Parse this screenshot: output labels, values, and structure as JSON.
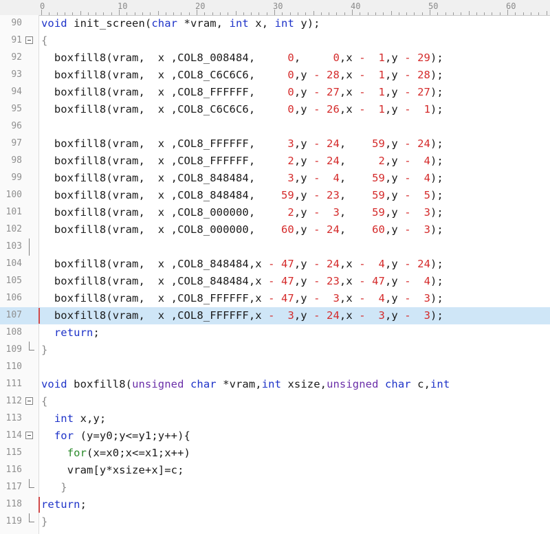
{
  "ruler": {
    "labels": [
      "0",
      "10",
      "20",
      "30",
      "40",
      "50",
      "60"
    ]
  },
  "lines": [
    {
      "n": "90",
      "tokens": [
        [
          "kw",
          "void"
        ],
        [
          "t",
          " init_screen("
        ],
        [
          "kw",
          "char"
        ],
        [
          "t",
          " *vram, "
        ],
        [
          "kw",
          "int"
        ],
        [
          "t",
          " x, "
        ],
        [
          "kw",
          "int"
        ],
        [
          "t",
          " y);"
        ]
      ]
    },
    {
      "n": "91",
      "fold": "open",
      "tokens": [
        [
          "brace",
          "{"
        ]
      ]
    },
    {
      "n": "92",
      "tokens": [
        [
          "t",
          "  boxfill8(vram,  x ,COL8_008484,     "
        ],
        [
          "num",
          "0"
        ],
        [
          "t",
          ",     "
        ],
        [
          "num",
          "0"
        ],
        [
          "t",
          ",x "
        ],
        [
          "op",
          "-"
        ],
        [
          "t",
          "  "
        ],
        [
          "num",
          "1"
        ],
        [
          "t",
          ",y "
        ],
        [
          "op",
          "-"
        ],
        [
          "t",
          " "
        ],
        [
          "num",
          "29"
        ],
        [
          "t",
          ");"
        ]
      ]
    },
    {
      "n": "93",
      "tokens": [
        [
          "t",
          "  boxfill8(vram,  x ,COL8_C6C6C6,     "
        ],
        [
          "num",
          "0"
        ],
        [
          "t",
          ",y "
        ],
        [
          "op",
          "-"
        ],
        [
          "t",
          " "
        ],
        [
          "num",
          "28"
        ],
        [
          "t",
          ",x "
        ],
        [
          "op",
          "-"
        ],
        [
          "t",
          "  "
        ],
        [
          "num",
          "1"
        ],
        [
          "t",
          ",y "
        ],
        [
          "op",
          "-"
        ],
        [
          "t",
          " "
        ],
        [
          "num",
          "28"
        ],
        [
          "t",
          ");"
        ]
      ]
    },
    {
      "n": "94",
      "tokens": [
        [
          "t",
          "  boxfill8(vram,  x ,COL8_FFFFFF,     "
        ],
        [
          "num",
          "0"
        ],
        [
          "t",
          ",y "
        ],
        [
          "op",
          "-"
        ],
        [
          "t",
          " "
        ],
        [
          "num",
          "27"
        ],
        [
          "t",
          ",x "
        ],
        [
          "op",
          "-"
        ],
        [
          "t",
          "  "
        ],
        [
          "num",
          "1"
        ],
        [
          "t",
          ",y "
        ],
        [
          "op",
          "-"
        ],
        [
          "t",
          " "
        ],
        [
          "num",
          "27"
        ],
        [
          "t",
          ");"
        ]
      ]
    },
    {
      "n": "95",
      "tokens": [
        [
          "t",
          "  boxfill8(vram,  x ,COL8_C6C6C6,     "
        ],
        [
          "num",
          "0"
        ],
        [
          "t",
          ",y "
        ],
        [
          "op",
          "-"
        ],
        [
          "t",
          " "
        ],
        [
          "num",
          "26"
        ],
        [
          "t",
          ",x "
        ],
        [
          "op",
          "-"
        ],
        [
          "t",
          "  "
        ],
        [
          "num",
          "1"
        ],
        [
          "t",
          ",y "
        ],
        [
          "op",
          "-"
        ],
        [
          "t",
          "  "
        ],
        [
          "num",
          "1"
        ],
        [
          "t",
          ");"
        ]
      ]
    },
    {
      "n": "96",
      "tokens": []
    },
    {
      "n": "97",
      "tokens": [
        [
          "t",
          "  boxfill8(vram,  x ,COL8_FFFFFF,     "
        ],
        [
          "num",
          "3"
        ],
        [
          "t",
          ",y "
        ],
        [
          "op",
          "-"
        ],
        [
          "t",
          " "
        ],
        [
          "num",
          "24"
        ],
        [
          "t",
          ",    "
        ],
        [
          "num",
          "59"
        ],
        [
          "t",
          ",y "
        ],
        [
          "op",
          "-"
        ],
        [
          "t",
          " "
        ],
        [
          "num",
          "24"
        ],
        [
          "t",
          ");"
        ]
      ]
    },
    {
      "n": "98",
      "tokens": [
        [
          "t",
          "  boxfill8(vram,  x ,COL8_FFFFFF,     "
        ],
        [
          "num",
          "2"
        ],
        [
          "t",
          ",y "
        ],
        [
          "op",
          "-"
        ],
        [
          "t",
          " "
        ],
        [
          "num",
          "24"
        ],
        [
          "t",
          ",     "
        ],
        [
          "num",
          "2"
        ],
        [
          "t",
          ",y "
        ],
        [
          "op",
          "-"
        ],
        [
          "t",
          "  "
        ],
        [
          "num",
          "4"
        ],
        [
          "t",
          ");"
        ]
      ]
    },
    {
      "n": "99",
      "tokens": [
        [
          "t",
          "  boxfill8(vram,  x ,COL8_848484,     "
        ],
        [
          "num",
          "3"
        ],
        [
          "t",
          ",y "
        ],
        [
          "op",
          "-"
        ],
        [
          "t",
          "  "
        ],
        [
          "num",
          "4"
        ],
        [
          "t",
          ",    "
        ],
        [
          "num",
          "59"
        ],
        [
          "t",
          ",y "
        ],
        [
          "op",
          "-"
        ],
        [
          "t",
          "  "
        ],
        [
          "num",
          "4"
        ],
        [
          "t",
          ");"
        ]
      ]
    },
    {
      "n": "100",
      "tokens": [
        [
          "t",
          "  boxfill8(vram,  x ,COL8_848484,    "
        ],
        [
          "num",
          "59"
        ],
        [
          "t",
          ",y "
        ],
        [
          "op",
          "-"
        ],
        [
          "t",
          " "
        ],
        [
          "num",
          "23"
        ],
        [
          "t",
          ",    "
        ],
        [
          "num",
          "59"
        ],
        [
          "t",
          ",y "
        ],
        [
          "op",
          "-"
        ],
        [
          "t",
          "  "
        ],
        [
          "num",
          "5"
        ],
        [
          "t",
          ");"
        ]
      ]
    },
    {
      "n": "101",
      "tokens": [
        [
          "t",
          "  boxfill8(vram,  x ,COL8_000000,     "
        ],
        [
          "num",
          "2"
        ],
        [
          "t",
          ",y "
        ],
        [
          "op",
          "-"
        ],
        [
          "t",
          "  "
        ],
        [
          "num",
          "3"
        ],
        [
          "t",
          ",    "
        ],
        [
          "num",
          "59"
        ],
        [
          "t",
          ",y "
        ],
        [
          "op",
          "-"
        ],
        [
          "t",
          "  "
        ],
        [
          "num",
          "3"
        ],
        [
          "t",
          ");"
        ]
      ]
    },
    {
      "n": "102",
      "tokens": [
        [
          "t",
          "  boxfill8(vram,  x ,COL8_000000,    "
        ],
        [
          "num",
          "60"
        ],
        [
          "t",
          ",y "
        ],
        [
          "op",
          "-"
        ],
        [
          "t",
          " "
        ],
        [
          "num",
          "24"
        ],
        [
          "t",
          ",    "
        ],
        [
          "num",
          "60"
        ],
        [
          "t",
          ",y "
        ],
        [
          "op",
          "-"
        ],
        [
          "t",
          "  "
        ],
        [
          "num",
          "3"
        ],
        [
          "t",
          ");"
        ]
      ]
    },
    {
      "n": "103",
      "fold": "vert",
      "tokens": []
    },
    {
      "n": "104",
      "tokens": [
        [
          "t",
          "  boxfill8(vram,  x ,COL8_848484,x "
        ],
        [
          "op",
          "-"
        ],
        [
          "t",
          " "
        ],
        [
          "num",
          "47"
        ],
        [
          "t",
          ",y "
        ],
        [
          "op",
          "-"
        ],
        [
          "t",
          " "
        ],
        [
          "num",
          "24"
        ],
        [
          "t",
          ",x "
        ],
        [
          "op",
          "-"
        ],
        [
          "t",
          "  "
        ],
        [
          "num",
          "4"
        ],
        [
          "t",
          ",y "
        ],
        [
          "op",
          "-"
        ],
        [
          "t",
          " "
        ],
        [
          "num",
          "24"
        ],
        [
          "t",
          ");"
        ]
      ]
    },
    {
      "n": "105",
      "tokens": [
        [
          "t",
          "  boxfill8(vram,  x ,COL8_848484,x "
        ],
        [
          "op",
          "-"
        ],
        [
          "t",
          " "
        ],
        [
          "num",
          "47"
        ],
        [
          "t",
          ",y "
        ],
        [
          "op",
          "-"
        ],
        [
          "t",
          " "
        ],
        [
          "num",
          "23"
        ],
        [
          "t",
          ",x "
        ],
        [
          "op",
          "-"
        ],
        [
          "t",
          " "
        ],
        [
          "num",
          "47"
        ],
        [
          "t",
          ",y "
        ],
        [
          "op",
          "-"
        ],
        [
          "t",
          "  "
        ],
        [
          "num",
          "4"
        ],
        [
          "t",
          ");"
        ]
      ]
    },
    {
      "n": "106",
      "tokens": [
        [
          "t",
          "  boxfill8(vram,  x ,COL8_FFFFFF,x "
        ],
        [
          "op",
          "-"
        ],
        [
          "t",
          " "
        ],
        [
          "num",
          "47"
        ],
        [
          "t",
          ",y "
        ],
        [
          "op",
          "-"
        ],
        [
          "t",
          "  "
        ],
        [
          "num",
          "3"
        ],
        [
          "t",
          ",x "
        ],
        [
          "op",
          "-"
        ],
        [
          "t",
          "  "
        ],
        [
          "num",
          "4"
        ],
        [
          "t",
          ",y "
        ],
        [
          "op",
          "-"
        ],
        [
          "t",
          "  "
        ],
        [
          "num",
          "3"
        ],
        [
          "t",
          ");"
        ]
      ]
    },
    {
      "n": "107",
      "highlight": true,
      "marker": true,
      "tokens": [
        [
          "t",
          "  boxfill8(vram,  x ,COL8_FFFFFF,x "
        ],
        [
          "op",
          "-"
        ],
        [
          "t",
          "  "
        ],
        [
          "num",
          "3"
        ],
        [
          "t",
          ",y "
        ],
        [
          "op",
          "-"
        ],
        [
          "t",
          " "
        ],
        [
          "num",
          "24"
        ],
        [
          "t",
          ",x "
        ],
        [
          "op",
          "-"
        ],
        [
          "t",
          "  "
        ],
        [
          "num",
          "3"
        ],
        [
          "t",
          ",y "
        ],
        [
          "op",
          "-"
        ],
        [
          "t",
          "  "
        ],
        [
          "num",
          "3"
        ],
        [
          "t",
          ");"
        ]
      ]
    },
    {
      "n": "108",
      "tokens": [
        [
          "t",
          "  "
        ],
        [
          "kw",
          "return"
        ],
        [
          "t",
          ";"
        ]
      ]
    },
    {
      "n": "109",
      "fold": "end",
      "tokens": [
        [
          "brace",
          "}"
        ]
      ]
    },
    {
      "n": "110",
      "tokens": []
    },
    {
      "n": "111",
      "tokens": [
        [
          "kw",
          "void"
        ],
        [
          "t",
          " boxfill8("
        ],
        [
          "ty",
          "unsigned"
        ],
        [
          "t",
          " "
        ],
        [
          "kw",
          "char"
        ],
        [
          "t",
          " *vram,"
        ],
        [
          "kw",
          "int"
        ],
        [
          "t",
          " xsize,"
        ],
        [
          "ty",
          "unsigned"
        ],
        [
          "t",
          " "
        ],
        [
          "kw",
          "char"
        ],
        [
          "t",
          " c,"
        ],
        [
          "kw",
          "int"
        ]
      ]
    },
    {
      "n": "112",
      "fold": "open",
      "tokens": [
        [
          "brace",
          "{"
        ]
      ]
    },
    {
      "n": "113",
      "tokens": [
        [
          "t",
          "  "
        ],
        [
          "kw",
          "int"
        ],
        [
          "t",
          " x,y;"
        ]
      ]
    },
    {
      "n": "114",
      "fold": "open",
      "tokens": [
        [
          "t",
          "  "
        ],
        [
          "kw",
          "for"
        ],
        [
          "t",
          " (y=y0;y<=y1;y++){"
        ]
      ]
    },
    {
      "n": "115",
      "tokens": [
        [
          "t",
          "    "
        ],
        [
          "grn",
          "for"
        ],
        [
          "t",
          "(x=x0;x<=x1;x++)"
        ]
      ]
    },
    {
      "n": "116",
      "tokens": [
        [
          "t",
          "    vram[y*xsize+x]=c;"
        ]
      ]
    },
    {
      "n": "117",
      "fold": "end",
      "tokens": [
        [
          "t",
          "   "
        ],
        [
          "brace",
          "}"
        ]
      ]
    },
    {
      "n": "118",
      "marker": true,
      "tokens": [
        [
          "kw",
          "return"
        ],
        [
          "t",
          ";"
        ]
      ]
    },
    {
      "n": "119",
      "fold": "end",
      "tokens": [
        [
          "brace",
          "}"
        ]
      ]
    }
  ]
}
